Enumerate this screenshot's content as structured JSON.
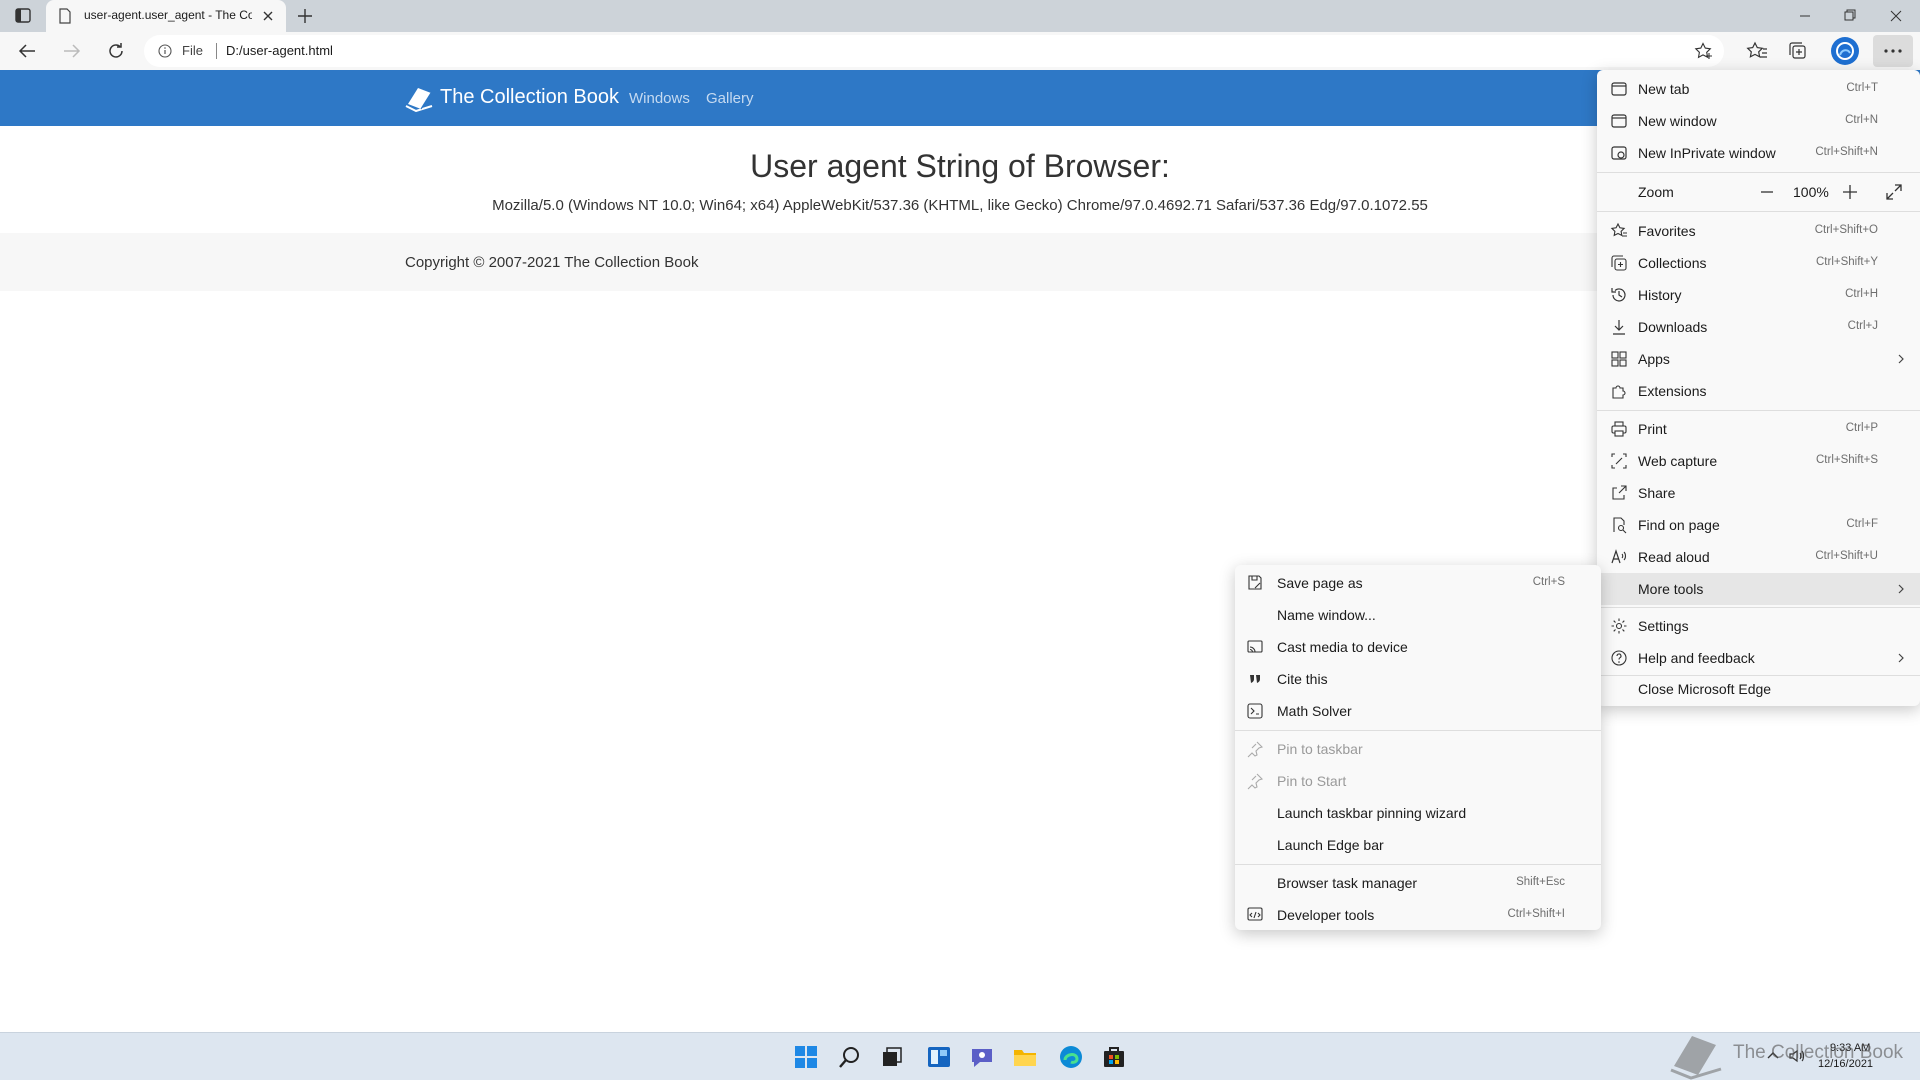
{
  "tab": {
    "title": "user-agent.user_agent - The Collection Book"
  },
  "address": {
    "scheme_label": "File",
    "url": "D:/user-agent.html"
  },
  "site": {
    "brand": "The Collection Book",
    "nav": [
      "Windows",
      "Gallery"
    ],
    "heading": "User agent String of Browser:",
    "user_agent": "Mozilla/5.0 (Windows NT 10.0; Win64; x64) AppleWebKit/537.36 (KHTML, like Gecko) Chrome/97.0.4692.71 Safari/537.36 Edg/97.0.1072.55",
    "copyright": "Copyright © 2007-2021 The Collection Book"
  },
  "menu": {
    "items": [
      {
        "label": "New tab",
        "shortcut": "Ctrl+T",
        "icon": "new-tab-icon"
      },
      {
        "label": "New window",
        "shortcut": "Ctrl+N",
        "icon": "new-window-icon"
      },
      {
        "label": "New InPrivate window",
        "shortcut": "Ctrl+Shift+N",
        "icon": "inprivate-icon"
      },
      {
        "label": "Zoom",
        "shortcut": "",
        "icon": ""
      },
      {
        "label": "Favorites",
        "shortcut": "Ctrl+Shift+O",
        "icon": "favorites-icon"
      },
      {
        "label": "Collections",
        "shortcut": "Ctrl+Shift+Y",
        "icon": "collections-icon"
      },
      {
        "label": "History",
        "shortcut": "Ctrl+H",
        "icon": "history-icon"
      },
      {
        "label": "Downloads",
        "shortcut": "Ctrl+J",
        "icon": "download-icon"
      },
      {
        "label": "Apps",
        "shortcut": "",
        "icon": "apps-icon"
      },
      {
        "label": "Extensions",
        "shortcut": "",
        "icon": "extensions-icon"
      },
      {
        "label": "Print",
        "shortcut": "Ctrl+P",
        "icon": "print-icon"
      },
      {
        "label": "Web capture",
        "shortcut": "Ctrl+Shift+S",
        "icon": "web-capture-icon"
      },
      {
        "label": "Share",
        "shortcut": "",
        "icon": "share-icon"
      },
      {
        "label": "Find on page",
        "shortcut": "Ctrl+F",
        "icon": "find-icon"
      },
      {
        "label": "Read aloud",
        "shortcut": "Ctrl+Shift+U",
        "icon": "read-aloud-icon"
      },
      {
        "label": "More tools",
        "shortcut": "",
        "icon": ""
      },
      {
        "label": "Settings",
        "shortcut": "",
        "icon": "settings-icon"
      },
      {
        "label": "Help and feedback",
        "shortcut": "",
        "icon": "help-icon"
      },
      {
        "label": "Close Microsoft Edge",
        "shortcut": "",
        "icon": ""
      }
    ],
    "zoom_value": "100%"
  },
  "submenu": {
    "items": [
      {
        "label": "Save page as",
        "shortcut": "Ctrl+S",
        "icon": "save-icon"
      },
      {
        "label": "Name window...",
        "shortcut": "",
        "icon": ""
      },
      {
        "label": "Cast media to device",
        "shortcut": "",
        "icon": "cast-icon"
      },
      {
        "label": "Cite this",
        "shortcut": "",
        "icon": "quote-icon"
      },
      {
        "label": "Math Solver",
        "shortcut": "",
        "icon": "math-solver-icon"
      },
      {
        "label": "Pin to taskbar",
        "shortcut": "",
        "icon": "pin-icon"
      },
      {
        "label": "Pin to Start",
        "shortcut": "",
        "icon": "pin-icon"
      },
      {
        "label": "Launch taskbar pinning wizard",
        "shortcut": "",
        "icon": ""
      },
      {
        "label": "Launch Edge bar",
        "shortcut": "",
        "icon": ""
      },
      {
        "label": "Browser task manager",
        "shortcut": "Shift+Esc",
        "icon": ""
      },
      {
        "label": "Developer tools",
        "shortcut": "Ctrl+Shift+I",
        "icon": "developer-tools-icon"
      }
    ]
  },
  "taskbar": {
    "time": "9:33 AM",
    "date": "12/16/2021"
  },
  "watermark": {
    "text": "The Collection Book"
  },
  "colors": {
    "brand_nav": "#2e78c6",
    "accent": "#1e6fd1"
  }
}
